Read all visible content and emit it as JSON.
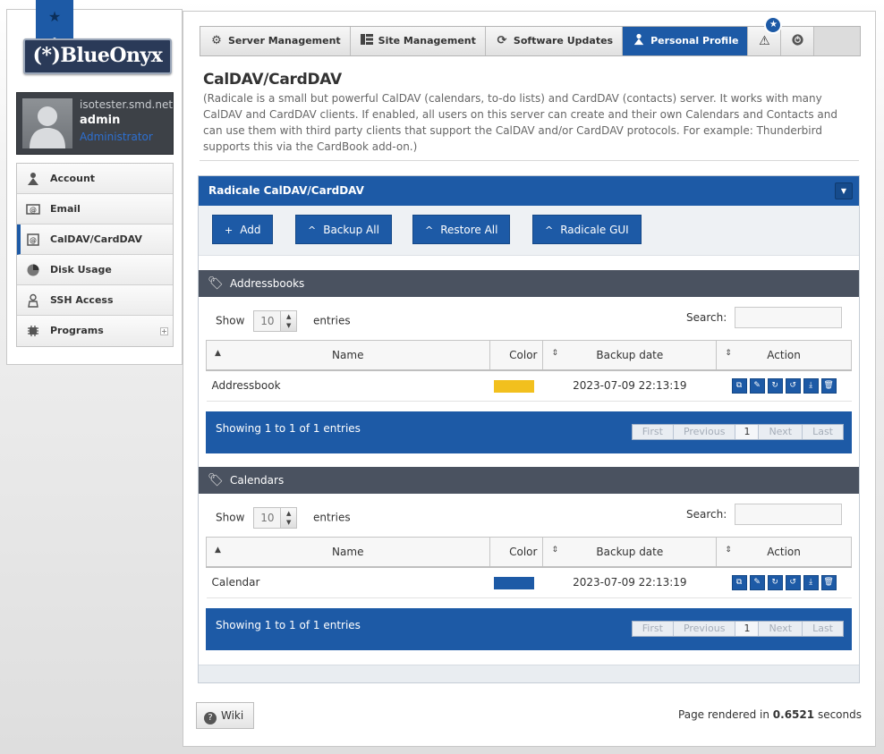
{
  "brand": {
    "logo_text": "(*)BlueOnyx"
  },
  "user": {
    "host": "isotester.smd.net",
    "name": "admin",
    "role": "Administrator"
  },
  "sidebar": {
    "items": [
      {
        "label": "Account",
        "icon": "person-icon"
      },
      {
        "label": "Email",
        "icon": "email-icon"
      },
      {
        "label": "CalDAV/CardDAV",
        "icon": "calendar-icon",
        "active": true
      },
      {
        "label": "Disk Usage",
        "icon": "pie-chart-icon"
      },
      {
        "label": "SSH Access",
        "icon": "user-shield-icon"
      },
      {
        "label": "Programs",
        "icon": "chip-icon",
        "expandable": true
      }
    ]
  },
  "nav": {
    "tabs": [
      {
        "label": "Server Management",
        "icon": "gear-icon"
      },
      {
        "label": "Site Management",
        "icon": "grid-icon"
      },
      {
        "label": "Software Updates",
        "icon": "refresh-icon"
      },
      {
        "label": "Personal Profile",
        "icon": "person-icon",
        "active": true
      }
    ],
    "badge_icon": "star-icon",
    "warning_icon": "warning-icon",
    "logout_icon": "power-icon"
  },
  "page": {
    "title": "CalDAV/CardDAV",
    "description": "(Radicale is a small but powerful CalDAV (calendars, to-do lists) and CardDAV (contacts) server. It works with many CalDAV and CardDAV clients. If enabled, all users on this server can create and their own Calendars and Contacts and can use them with third party clients that support the CalDAV and/or CardDAV protocols. For example: Thunderbird supports this via the CardBook add-on.)"
  },
  "box": {
    "title": "Radicale CalDAV/CardDAV",
    "buttons": [
      {
        "label": "Add",
        "icon": "+"
      },
      {
        "label": "Backup All",
        "icon": "^"
      },
      {
        "label": "Restore All",
        "icon": "^"
      },
      {
        "label": "Radicale GUI",
        "icon": "^"
      }
    ]
  },
  "addressbooks": {
    "title": "Addressbooks",
    "show_label": "Show",
    "page_length": "10",
    "entries_label": "entries",
    "search_label": "Search:",
    "columns": [
      "Name",
      "Color",
      "Backup date",
      "Action"
    ],
    "rows": [
      {
        "name": "Addressbook",
        "color": "#f2c01e",
        "backup_date": "2023-07-09 22:13:19"
      }
    ],
    "info": "Showing 1 to 1 of 1 entries",
    "pager": {
      "first": "First",
      "previous": "Previous",
      "current": "1",
      "next": "Next",
      "last": "Last"
    }
  },
  "calendars": {
    "title": "Calendars",
    "show_label": "Show",
    "page_length": "10",
    "entries_label": "entries",
    "search_label": "Search:",
    "columns": [
      "Name",
      "Color",
      "Backup date",
      "Action"
    ],
    "rows": [
      {
        "name": "Calendar",
        "color": "#1d5aa6",
        "backup_date": "2023-07-09 22:13:19"
      }
    ],
    "info": "Showing 1 to 1 of 1 entries",
    "pager": {
      "first": "First",
      "previous": "Previous",
      "current": "1",
      "next": "Next",
      "last": "Last"
    }
  },
  "row_actions": [
    "copy-icon",
    "edit-icon",
    "refresh-icon",
    "restore-icon",
    "download-icon",
    "trash-icon"
  ],
  "footer": {
    "wiki_label": "Wiki",
    "render_prefix": "Page rendered in",
    "render_time": "0.6521",
    "render_suffix": "seconds"
  },
  "colors": {
    "accent": "#1d5aa6",
    "section_header": "#4a5260",
    "addressbook_swatch": "#f2c01e"
  }
}
